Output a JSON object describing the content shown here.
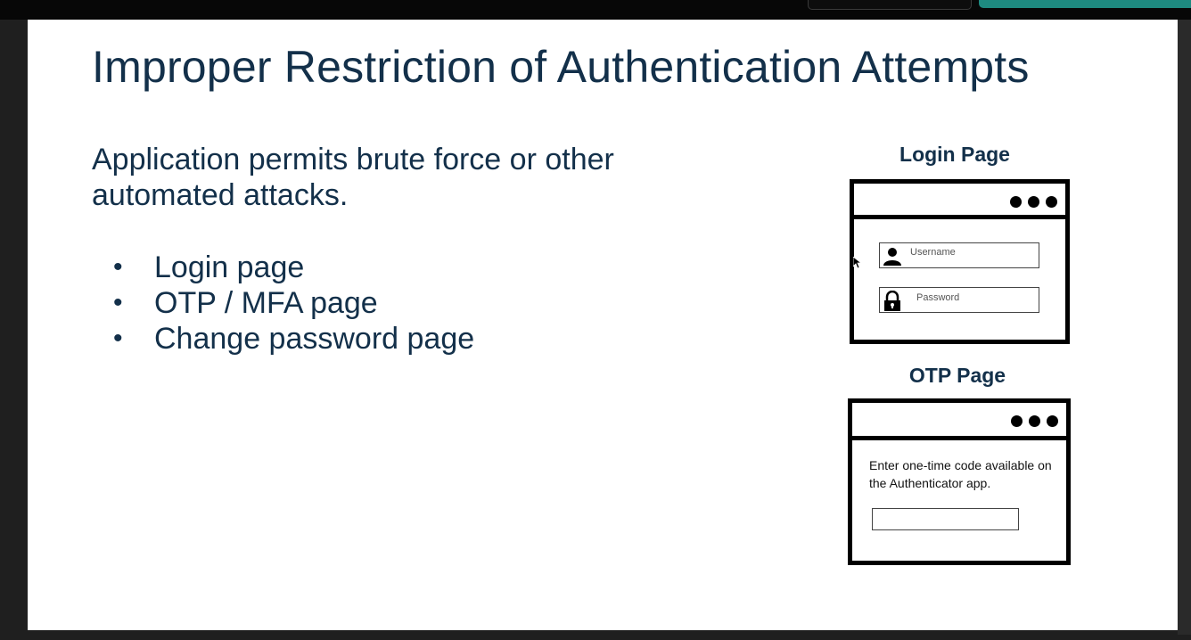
{
  "slide": {
    "title": "Improper Restriction of Authentication Attempts",
    "intro": "Application permits brute force or other automated attacks.",
    "bullets": [
      "Login page",
      "OTP / MFA page",
      "Change password page"
    ]
  },
  "login_mock": {
    "caption": "Login Page",
    "username_placeholder": "Username",
    "password_placeholder": "Password",
    "icons": [
      "user-icon",
      "lock-icon",
      "more-dots-icon"
    ]
  },
  "otp_mock": {
    "caption": "OTP Page",
    "instruction": "Enter one-time code available on the Authenticator app.",
    "icons": [
      "more-dots-icon"
    ]
  },
  "colors": {
    "title_text": "#13304a",
    "slide_bg": "#ffffff",
    "frame_bg": "#1f1f1f",
    "accent_button": "#1e8a80"
  }
}
